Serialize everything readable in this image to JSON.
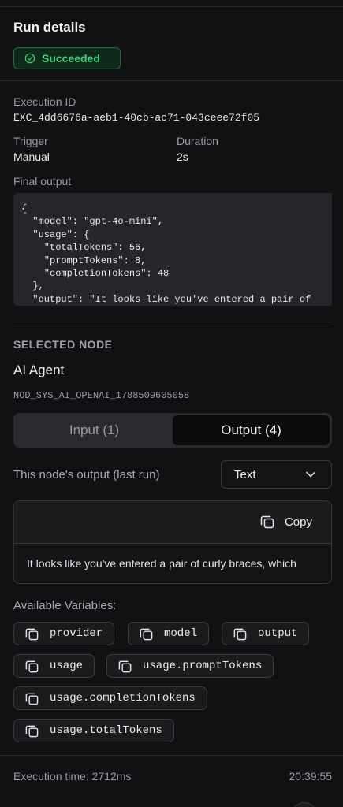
{
  "header": {
    "title": "Run details",
    "status": "Succeeded"
  },
  "execution": {
    "id_label": "Execution ID",
    "id_value": "EXC_4dd6676a-aeb1-40cb-ac71-043ceee72f05",
    "trigger_label": "Trigger",
    "trigger_value": "Manual",
    "duration_label": "Duration",
    "duration_value": "2s",
    "final_output_label": "Final output",
    "final_output_code": "{\n  \"model\": \"gpt-4o-mini\",\n  \"usage\": {\n    \"totalTokens\": 56,\n    \"promptTokens\": 8,\n    \"completionTokens\": 48\n  },\n  \"output\": \"It looks like you've entered a pair of"
  },
  "selected_node": {
    "section_label": "SELECTED NODE",
    "name": "AI Agent",
    "id": "NOD_SYS_AI_OPENAI_1788509605058",
    "tabs": [
      {
        "label": "Input (1)",
        "active": false
      },
      {
        "label": "Output (4)",
        "active": true
      }
    ],
    "output_select_label": "This node's output (last run)",
    "output_format": "Text",
    "copy_label": "Copy",
    "output_text": "It looks like you've entered a pair of curly braces, which",
    "variables_label": "Available Variables:",
    "variables": [
      "provider",
      "model",
      "output",
      "usage",
      "usage.promptTokens",
      "usage.completionTokens",
      "usage.totalTokens"
    ]
  },
  "footer": {
    "execution_time": "Execution time: 2712ms",
    "timestamp": "20:39:55"
  },
  "colors": {
    "success": "#3fcf74",
    "background": "#111113"
  }
}
